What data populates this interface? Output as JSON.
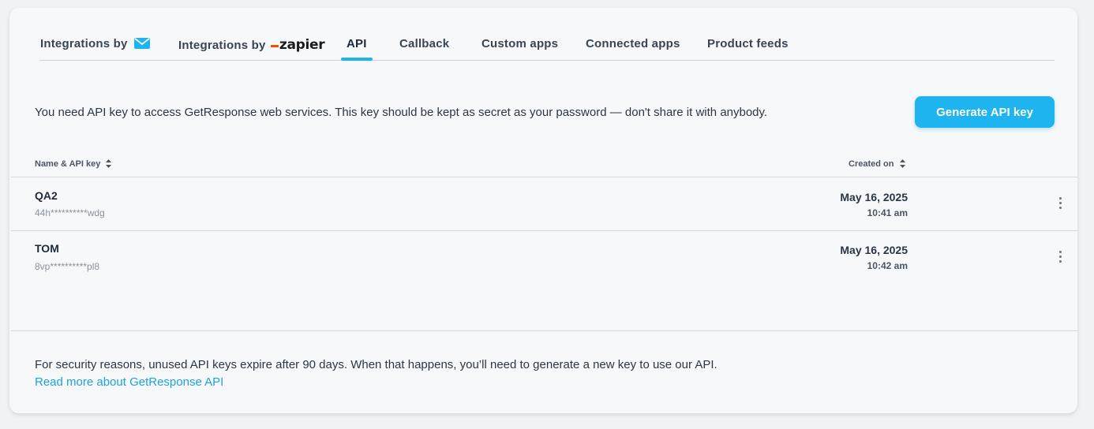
{
  "tabs": [
    {
      "label": "Integrations by",
      "icon": "envelope-icon"
    },
    {
      "label": "Integrations by",
      "brand": "zapier"
    },
    {
      "label": "API",
      "active": true
    },
    {
      "label": "Callback"
    },
    {
      "label": "Custom apps"
    },
    {
      "label": "Connected apps"
    },
    {
      "label": "Product feeds"
    }
  ],
  "intro_text": "You need API key to access GetResponse web services. This key should be kept as secret as your password — don't share it with anybody.",
  "generate_button": "Generate API key",
  "table": {
    "headers": {
      "name": "Name & API key",
      "created": "Created on"
    },
    "rows": [
      {
        "name": "QA2",
        "key": "44h**********wdg",
        "date": "May 16, 2025",
        "time": "10:41 am"
      },
      {
        "name": "TOM",
        "key": "8vp**********pl8",
        "date": "May 16, 2025",
        "time": "10:42 am"
      }
    ]
  },
  "footer": {
    "text": "For security reasons, unused API keys expire after 90 days. When that happens, you’ll need to generate a new key to use our API.",
    "link": "Read more about GetResponse API"
  },
  "colors": {
    "accent": "#1db4ef",
    "link": "#1aa3dc",
    "zapier": "#ff4a00"
  }
}
